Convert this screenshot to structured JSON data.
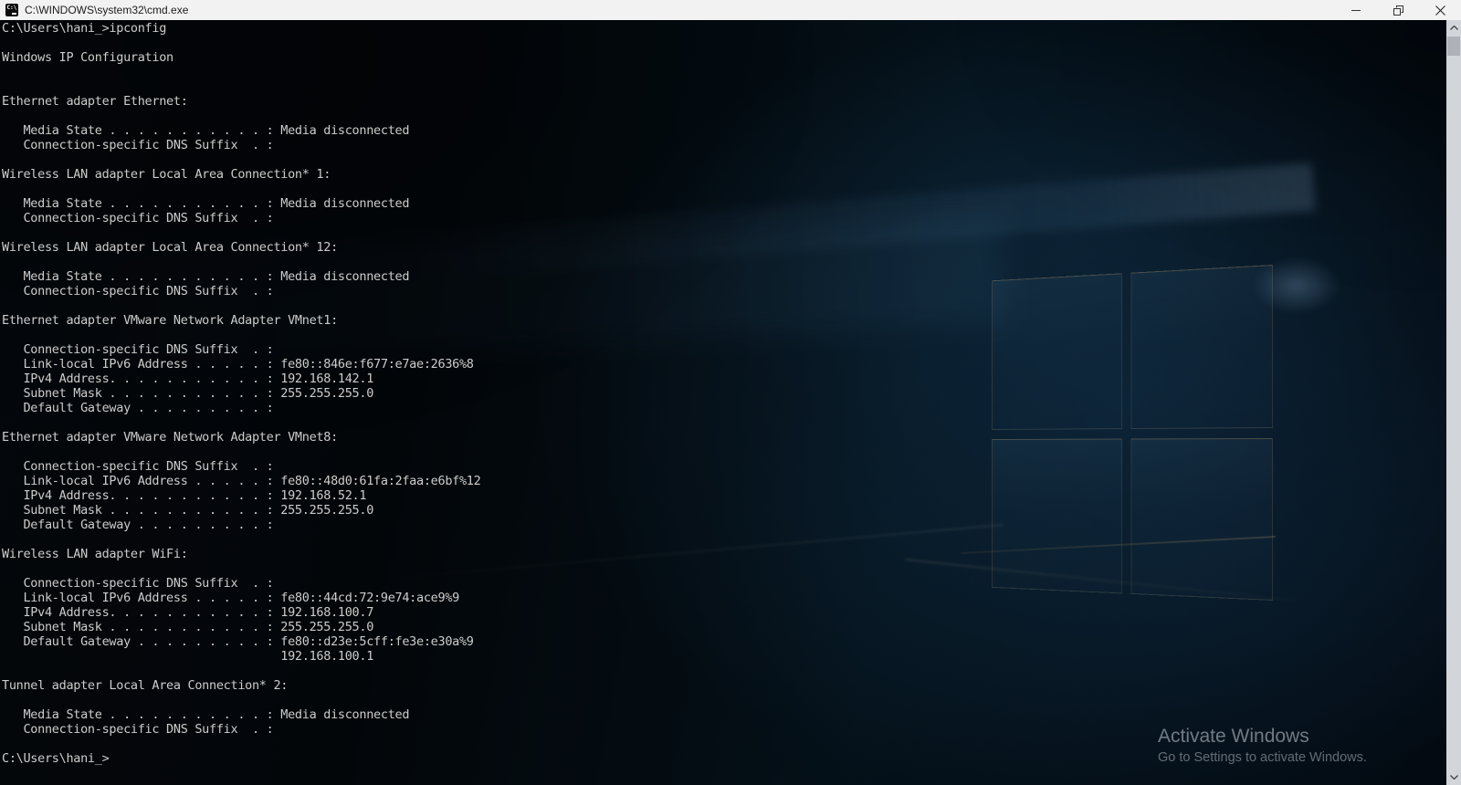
{
  "window": {
    "title": "C:\\WINDOWS\\system32\\cmd.exe"
  },
  "terminal": {
    "lines": [
      "C:\\Users\\hani_>ipconfig",
      "",
      "Windows IP Configuration",
      "",
      "",
      "Ethernet adapter Ethernet:",
      "",
      "   Media State . . . . . . . . . . . : Media disconnected",
      "   Connection-specific DNS Suffix  . :",
      "",
      "Wireless LAN adapter Local Area Connection* 1:",
      "",
      "   Media State . . . . . . . . . . . : Media disconnected",
      "   Connection-specific DNS Suffix  . :",
      "",
      "Wireless LAN adapter Local Area Connection* 12:",
      "",
      "   Media State . . . . . . . . . . . : Media disconnected",
      "   Connection-specific DNS Suffix  . :",
      "",
      "Ethernet adapter VMware Network Adapter VMnet1:",
      "",
      "   Connection-specific DNS Suffix  . :",
      "   Link-local IPv6 Address . . . . . : fe80::846e:f677:e7ae:2636%8",
      "   IPv4 Address. . . . . . . . . . . : 192.168.142.1",
      "   Subnet Mask . . . . . . . . . . . : 255.255.255.0",
      "   Default Gateway . . . . . . . . . :",
      "",
      "Ethernet adapter VMware Network Adapter VMnet8:",
      "",
      "   Connection-specific DNS Suffix  . :",
      "   Link-local IPv6 Address . . . . . : fe80::48d0:61fa:2faa:e6bf%12",
      "   IPv4 Address. . . . . . . . . . . : 192.168.52.1",
      "   Subnet Mask . . . . . . . . . . . : 255.255.255.0",
      "   Default Gateway . . . . . . . . . :",
      "",
      "Wireless LAN adapter WiFi:",
      "",
      "   Connection-specific DNS Suffix  . :",
      "   Link-local IPv6 Address . . . . . : fe80::44cd:72:9e74:ace9%9",
      "   IPv4 Address. . . . . . . . . . . : 192.168.100.7",
      "   Subnet Mask . . . . . . . . . . . : 255.255.255.0",
      "   Default Gateway . . . . . . . . . : fe80::d23e:5cff:fe3e:e30a%9",
      "                                       192.168.100.1",
      "",
      "Tunnel adapter Local Area Connection* 2:",
      "",
      "   Media State . . . . . . . . . . . : Media disconnected",
      "   Connection-specific DNS Suffix  . :",
      "",
      "C:\\Users\\hani_>"
    ]
  },
  "watermark": {
    "title": "Activate Windows",
    "subtitle": "Go to Settings to activate Windows."
  },
  "colors": {
    "console_text": "#cccccc",
    "titlebar_bg": "#f2f2f2",
    "scrollbar_track": "#d2d5da",
    "scrollbar_thumb": "#aeb2b8"
  }
}
